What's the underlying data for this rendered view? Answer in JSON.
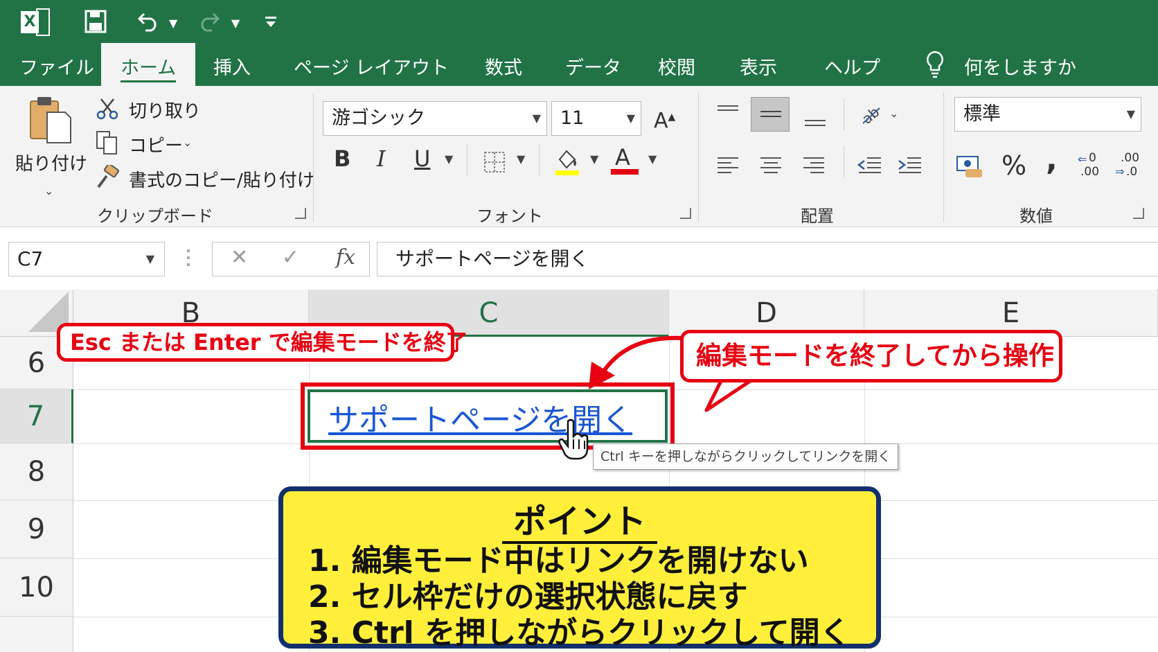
{
  "titlebar": {
    "logo_letter": "X",
    "qat_icons": [
      "save-icon",
      "undo-icon",
      "redo-icon",
      "customize-icon"
    ]
  },
  "tabs": [
    "ファイル",
    "ホーム",
    "挿入",
    "ページ レイアウト",
    "数式",
    "データ",
    "校閲",
    "表示",
    "ヘルプ"
  ],
  "active_tab": "ホーム",
  "tell_me": "何をしますか",
  "ribbon": {
    "clipboard": {
      "paste": "貼り付け",
      "cut": "切り取り",
      "copy": "コピー",
      "format_painter": "書式のコピー/貼り付け",
      "label": "クリップボード"
    },
    "font": {
      "font_name": "游ゴシック",
      "font_size": "11",
      "bold": "B",
      "italic": "I",
      "underline": "U",
      "font_color_letter": "A",
      "grow_letter": "A",
      "label": "フォント",
      "fill_color": "#ffff00",
      "text_color": "#e60012"
    },
    "alignment": {
      "label": "配置"
    },
    "number": {
      "format": "標準",
      "percent": "%",
      "comma": ",",
      "inc_decimal": ".00",
      "dec_decimal": ".0",
      "label": "数値"
    }
  },
  "formula_bar": {
    "name_box": "C7",
    "fx": "fx",
    "content": "サポートページを開く"
  },
  "grid": {
    "columns": [
      "B",
      "C",
      "D",
      "E"
    ],
    "selected_column": "C",
    "rows": [
      "6",
      "7",
      "8",
      "9",
      "10"
    ],
    "selected_row": "7",
    "cell_c7": "サポートページを開く"
  },
  "tooltip": "Ctrl キーを押しながらクリックしてリンクを開く",
  "callouts": {
    "left": "Esc または Enter で編集モードを終了",
    "right": "編集モードを終了してから操作"
  },
  "point": {
    "title": "ポイント",
    "lines": [
      "1.  編集モード中はリンクを開けない",
      "2.  セル枠だけの選択状態に戻す",
      "3.  Ctrl を押しながらクリックして開く"
    ]
  },
  "colors": {
    "excel_green": "#217346",
    "callout_red": "#e60012",
    "point_yellow": "#ffef3b",
    "point_border": "#13306c",
    "link_blue": "#1a56d6"
  }
}
